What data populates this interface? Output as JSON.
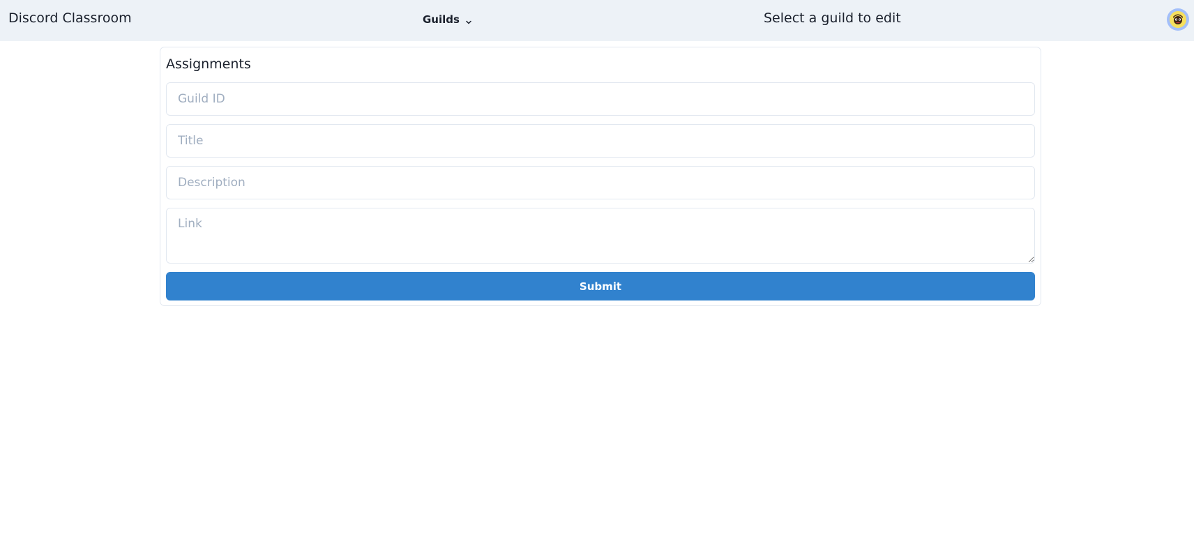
{
  "navbar": {
    "brand": "Discord Classroom",
    "guilds_label": "Guilds",
    "select_hint": "Select a guild to edit",
    "avatar_icon": "user-avatar",
    "background": "#edf2f7"
  },
  "form": {
    "title": "Assignments",
    "fields": {
      "guild_id": {
        "placeholder": "Guild ID",
        "value": ""
      },
      "title": {
        "placeholder": "Title",
        "value": ""
      },
      "description": {
        "placeholder": "Description",
        "value": ""
      },
      "link": {
        "placeholder": "Link",
        "value": ""
      }
    },
    "submit_label": "Submit",
    "submit_color": "#3182ce"
  }
}
